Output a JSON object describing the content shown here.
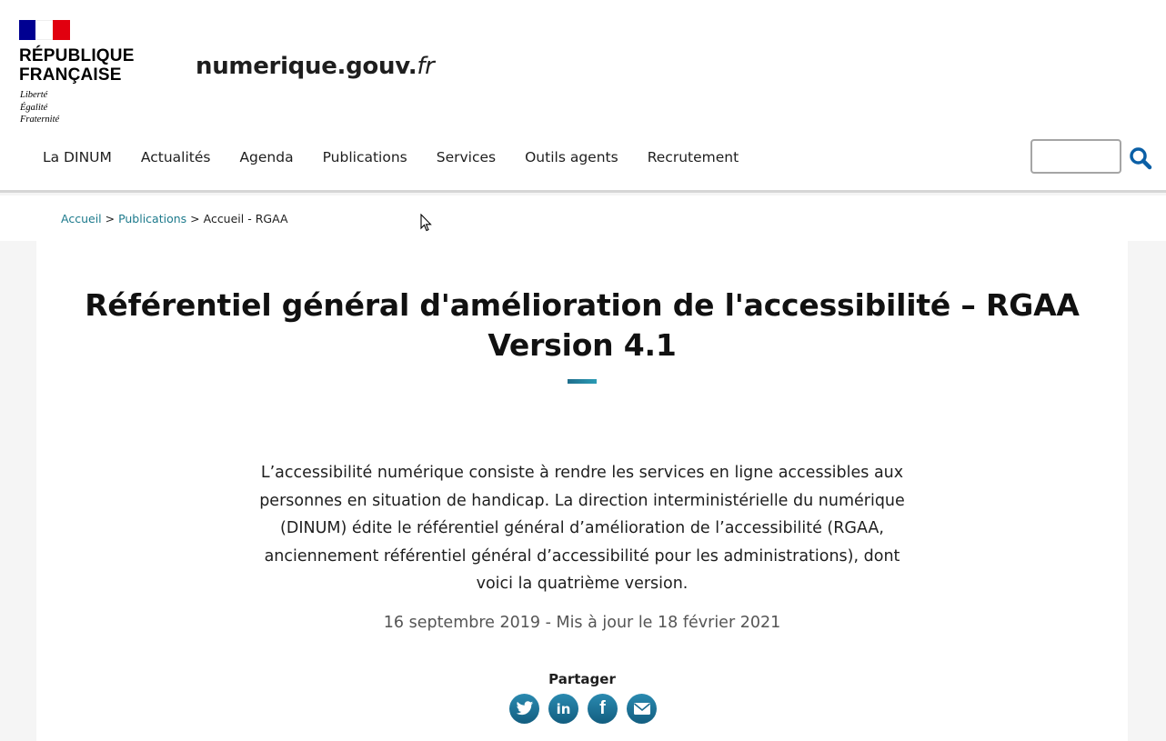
{
  "brand": {
    "republic_line1": "RÉPUBLIQUE",
    "republic_line2": "FRANÇAISE",
    "motto_1": "Liberté",
    "motto_2": "Égalité",
    "motto_3": "Fraternité",
    "site_name": "numerique.gouv.",
    "site_tld": "fr",
    "flag_colors": [
      "#000091",
      "#ffffff",
      "#e1000f"
    ]
  },
  "nav": {
    "items": [
      {
        "label": "La DINUM"
      },
      {
        "label": "Actualités"
      },
      {
        "label": "Agenda"
      },
      {
        "label": "Publications"
      },
      {
        "label": "Services"
      },
      {
        "label": "Outils agents"
      },
      {
        "label": "Recrutement"
      }
    ]
  },
  "search": {
    "value": "",
    "icon": "search-icon"
  },
  "breadcrumb": {
    "home": "Accueil",
    "sep1": " > ",
    "section": "Publications",
    "sep2": " > ",
    "current": "Accueil - RGAA"
  },
  "article": {
    "title_line1": "Référentiel général d'amélioration de l'accessibilité – RGAA",
    "title_line2": "Version 4.1",
    "intro": "L’accessibilité numérique consiste à rendre les services en ligne accessibles aux personnes en situation de handicap. La direction interministérielle du numérique (DINUM) édite le référentiel général d’amélioration de l’accessibilité (RGAA, anciennement référentiel général d’accessibilité pour les administrations), dont voici la quatrième version.",
    "date": "16 septembre 2019 - Mis à jour le 18 février 2021"
  },
  "share": {
    "label": "Partager",
    "icons": [
      "twitter-icon",
      "linkedin-icon",
      "facebook-icon",
      "email-icon"
    ],
    "linkedin_glyph": "in",
    "facebook_glyph": "f"
  },
  "colors": {
    "accent": "#1d7a8c",
    "share_icon": "#1f7aa0"
  }
}
